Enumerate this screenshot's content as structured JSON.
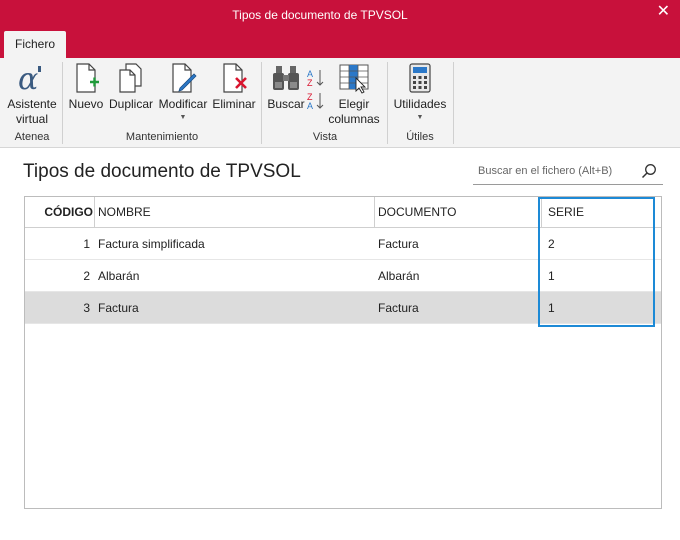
{
  "window": {
    "title": "Tipos de documento de TPVSOL",
    "close": "✕"
  },
  "tabs": [
    {
      "label": "Fichero"
    }
  ],
  "ribbon": {
    "groups": [
      {
        "label": "Atenea",
        "buttons": [
          {
            "label": "Asistente virtual",
            "icon": "alpha-icon"
          }
        ]
      },
      {
        "label": "Mantenimiento",
        "buttons": [
          {
            "label": "Nuevo",
            "icon": "new-document-icon"
          },
          {
            "label": "Duplicar",
            "icon": "duplicate-icon"
          },
          {
            "label": "Modificar",
            "icon": "edit-document-icon"
          },
          {
            "label": "Eliminar",
            "icon": "delete-document-icon"
          }
        ]
      },
      {
        "label": "Vista",
        "buttons": [
          {
            "label": "Buscar",
            "icon": "binoculars-icon"
          },
          {
            "label": "",
            "icon": "sort-icon"
          },
          {
            "label": "Elegir columnas",
            "icon": "columns-icon"
          }
        ]
      },
      {
        "label": "Útiles",
        "buttons": [
          {
            "label": "Utilidades",
            "icon": "calculator-icon"
          }
        ]
      }
    ]
  },
  "main": {
    "title": "Tipos de documento de TPVSOL",
    "search": {
      "placeholder": "Buscar en el fichero (Alt+B)"
    },
    "table": {
      "headers": {
        "code": "CÓDIGO",
        "nombre": "NOMBRE",
        "documento": "DOCUMENTO",
        "serie": "SERIE"
      },
      "rows": [
        {
          "code": "1",
          "nombre": "Factura simplificada",
          "documento": "Factura",
          "serie": "2",
          "selected": false
        },
        {
          "code": "2",
          "nombre": "Albarán",
          "documento": "Albarán",
          "serie": "1",
          "selected": false
        },
        {
          "code": "3",
          "nombre": "Factura",
          "documento": "Factura",
          "serie": "1",
          "selected": true
        }
      ]
    }
  },
  "colors": {
    "titlebar": "#c8113b",
    "highlight": "#1d8ad6",
    "selected_row": "#dcdcdc"
  }
}
